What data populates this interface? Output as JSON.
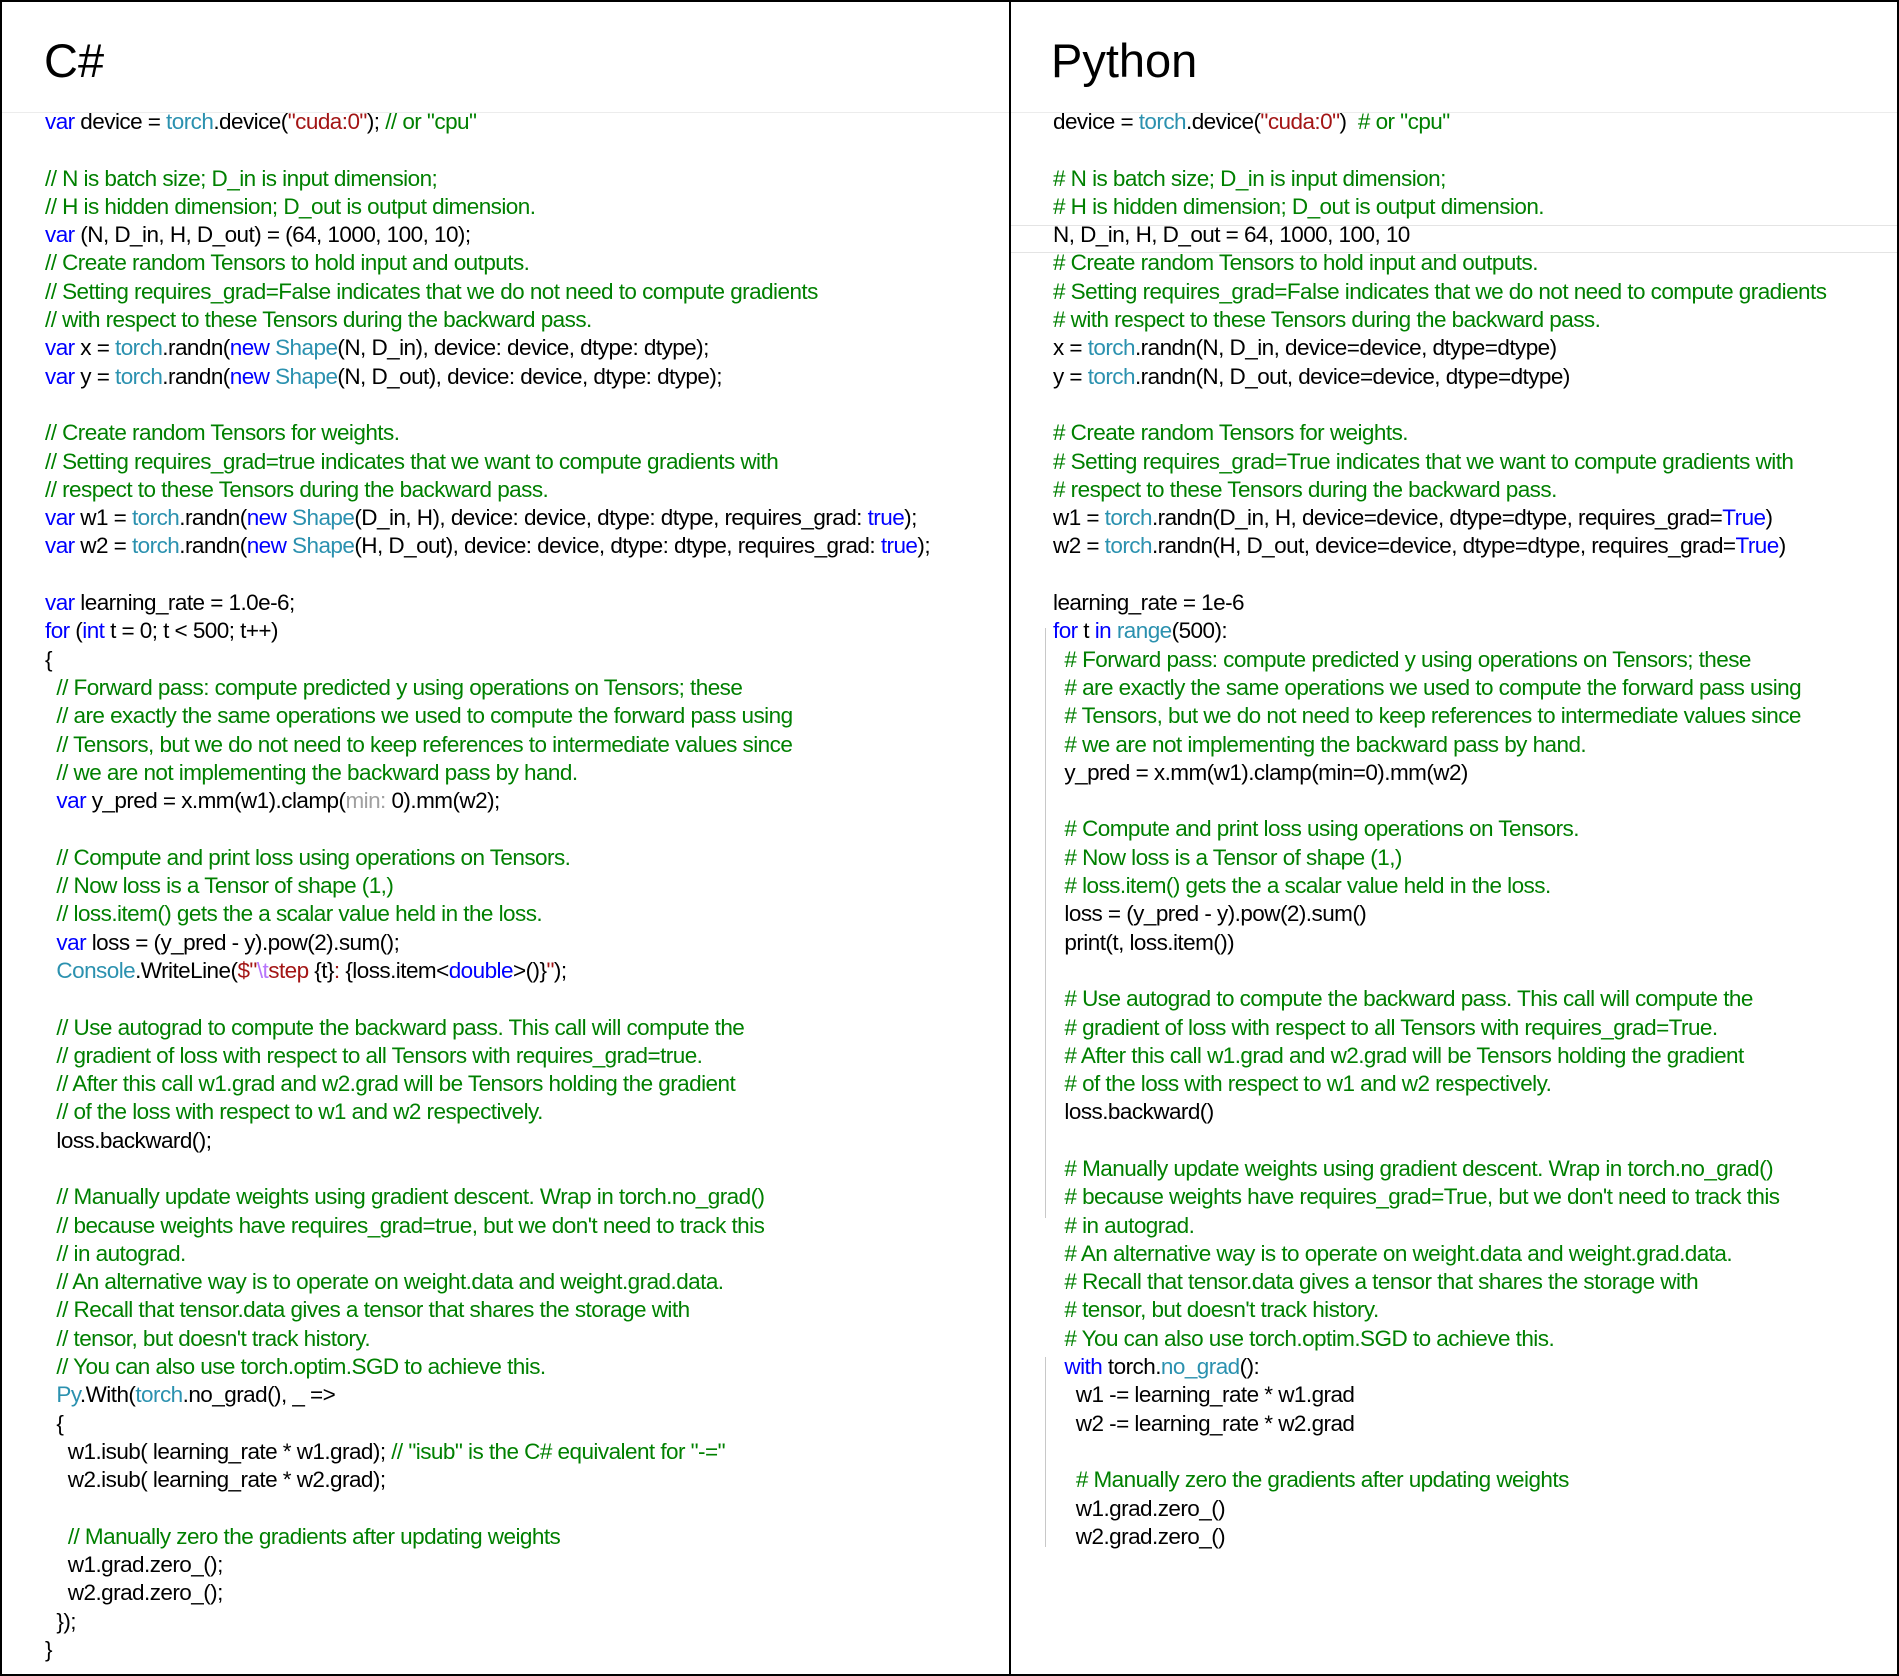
{
  "colors": {
    "keyword": "#0000ff",
    "type": "#2b91af",
    "comment": "#008000",
    "string": "#a31515",
    "escape": "#b776fb",
    "hint": "#a0a0a0",
    "text": "#000000"
  },
  "panels": [
    {
      "id": "csharp",
      "title": "C#",
      "lines": [
        [
          [
            "var",
            "kw"
          ],
          [
            " device = ",
            ""
          ],
          [
            "torch",
            "type"
          ],
          [
            ".device(",
            ""
          ],
          [
            "\"cuda:0\"",
            "str"
          ],
          [
            "); ",
            ""
          ],
          [
            "// or \"cpu\"",
            "cmt"
          ]
        ],
        [],
        [
          [
            "// N is batch size; D_in is input dimension;",
            "cmt"
          ]
        ],
        [
          [
            "// H is hidden dimension; D_out is output dimension.",
            "cmt"
          ]
        ],
        [
          [
            "var",
            "kw"
          ],
          [
            " (N, D_in, H, D_out) = (64, 1000, 100, 10);",
            ""
          ]
        ],
        [
          [
            "// Create random Tensors to hold input and outputs.",
            "cmt"
          ]
        ],
        [
          [
            "// Setting requires_grad=False indicates that we do not need to compute gradients",
            "cmt"
          ]
        ],
        [
          [
            "// with respect to these Tensors during the backward pass.",
            "cmt"
          ]
        ],
        [
          [
            "var",
            "kw"
          ],
          [
            " x = ",
            ""
          ],
          [
            "torch",
            "type"
          ],
          [
            ".randn(",
            ""
          ],
          [
            "new",
            "kw"
          ],
          [
            " ",
            ""
          ],
          [
            "Shape",
            "type"
          ],
          [
            "(N, D_in), device: device, dtype: dtype);",
            ""
          ]
        ],
        [
          [
            "var",
            "kw"
          ],
          [
            " y = ",
            ""
          ],
          [
            "torch",
            "type"
          ],
          [
            ".randn(",
            ""
          ],
          [
            "new",
            "kw"
          ],
          [
            " ",
            ""
          ],
          [
            "Shape",
            "type"
          ],
          [
            "(N, D_out), device: device, dtype: dtype);",
            ""
          ]
        ],
        [],
        [
          [
            "// Create random Tensors for weights.",
            "cmt"
          ]
        ],
        [
          [
            "// Setting requires_grad=true indicates that we want to compute gradients with",
            "cmt"
          ]
        ],
        [
          [
            "// respect to these Tensors during the backward pass.",
            "cmt"
          ]
        ],
        [
          [
            "var",
            "kw"
          ],
          [
            " w1 = ",
            ""
          ],
          [
            "torch",
            "type"
          ],
          [
            ".randn(",
            ""
          ],
          [
            "new",
            "kw"
          ],
          [
            " ",
            ""
          ],
          [
            "Shape",
            "type"
          ],
          [
            "(D_in, H), device: device, dtype: dtype, requires_grad: ",
            ""
          ],
          [
            "true",
            "kw"
          ],
          [
            ");",
            ""
          ]
        ],
        [
          [
            "var",
            "kw"
          ],
          [
            " w2 = ",
            ""
          ],
          [
            "torch",
            "type"
          ],
          [
            ".randn(",
            ""
          ],
          [
            "new",
            "kw"
          ],
          [
            " ",
            ""
          ],
          [
            "Shape",
            "type"
          ],
          [
            "(H, D_out), device: device, dtype: dtype, requires_grad: ",
            ""
          ],
          [
            "true",
            "kw"
          ],
          [
            ");",
            ""
          ]
        ],
        [],
        [
          [
            "var",
            "kw"
          ],
          [
            " learning_rate = 1.0e-6;",
            ""
          ]
        ],
        [
          [
            "for",
            "kw"
          ],
          [
            " (",
            ""
          ],
          [
            "int",
            "kw"
          ],
          [
            " t = 0; t < 500; t++)",
            ""
          ]
        ],
        [
          [
            "{",
            ""
          ]
        ],
        [
          [
            "  ",
            ""
          ],
          [
            "// Forward pass: compute predicted y using operations on Tensors; these",
            "cmt"
          ]
        ],
        [
          [
            "  ",
            ""
          ],
          [
            "// are exactly the same operations we used to compute the forward pass using",
            "cmt"
          ]
        ],
        [
          [
            "  ",
            ""
          ],
          [
            "// Tensors, but we do not need to keep references to intermediate values since",
            "cmt"
          ]
        ],
        [
          [
            "  ",
            ""
          ],
          [
            "// we are not implementing the backward pass by hand.",
            "cmt"
          ]
        ],
        [
          [
            "  ",
            ""
          ],
          [
            "var",
            "kw"
          ],
          [
            " y_pred = x.mm(w1).clamp(",
            ""
          ],
          [
            "min:",
            "hint"
          ],
          [
            " 0).mm(w2);",
            ""
          ]
        ],
        [],
        [
          [
            "  ",
            ""
          ],
          [
            "// Compute and print loss using operations on Tensors.",
            "cmt"
          ]
        ],
        [
          [
            "  ",
            ""
          ],
          [
            "// Now loss is a Tensor of shape (1,)",
            "cmt"
          ]
        ],
        [
          [
            "  ",
            ""
          ],
          [
            "// loss.item() gets the a scalar value held in the loss.",
            "cmt"
          ]
        ],
        [
          [
            "  ",
            ""
          ],
          [
            "var",
            "kw"
          ],
          [
            " loss = (y_pred - y).pow(2).sum();",
            ""
          ]
        ],
        [
          [
            "  ",
            ""
          ],
          [
            "Console",
            "type"
          ],
          [
            ".WriteLine(",
            ""
          ],
          [
            "$\"",
            "str"
          ],
          [
            "\\t",
            "esc"
          ],
          [
            "step ",
            "str"
          ],
          [
            "{t}",
            ""
          ],
          [
            ": ",
            "str"
          ],
          [
            "{loss.item<",
            ""
          ],
          [
            "double",
            "kw"
          ],
          [
            ">()}",
            ""
          ],
          [
            "\"",
            "str"
          ],
          [
            ");",
            ""
          ]
        ],
        [],
        [
          [
            "  ",
            ""
          ],
          [
            "// Use autograd to compute the backward pass. This call will compute the",
            "cmt"
          ]
        ],
        [
          [
            "  ",
            ""
          ],
          [
            "// gradient of loss with respect to all Tensors with requires_grad=true.",
            "cmt"
          ]
        ],
        [
          [
            "  ",
            ""
          ],
          [
            "// After this call w1.grad and w2.grad will be Tensors holding the gradient",
            "cmt"
          ]
        ],
        [
          [
            "  ",
            ""
          ],
          [
            "// of the loss with respect to w1 and w2 respectively.",
            "cmt"
          ]
        ],
        [
          [
            "  loss.backward();",
            ""
          ]
        ],
        [],
        [
          [
            "  ",
            ""
          ],
          [
            "// Manually update weights using gradient descent. Wrap in torch.no_grad()",
            "cmt"
          ]
        ],
        [
          [
            "  ",
            ""
          ],
          [
            "// because weights have requires_grad=true, but we don't need to track this",
            "cmt"
          ]
        ],
        [
          [
            "  ",
            ""
          ],
          [
            "// in autograd.",
            "cmt"
          ]
        ],
        [
          [
            "  ",
            ""
          ],
          [
            "// An alternative way is to operate on weight.data and weight.grad.data.",
            "cmt"
          ]
        ],
        [
          [
            "  ",
            ""
          ],
          [
            "// Recall that tensor.data gives a tensor that shares the storage with",
            "cmt"
          ]
        ],
        [
          [
            "  ",
            ""
          ],
          [
            "// tensor, but doesn't track history.",
            "cmt"
          ]
        ],
        [
          [
            "  ",
            ""
          ],
          [
            "// You can also use torch.optim.SGD to achieve this.",
            "cmt"
          ]
        ],
        [
          [
            "  ",
            ""
          ],
          [
            "Py",
            "type"
          ],
          [
            ".With(",
            ""
          ],
          [
            "torch",
            "type"
          ],
          [
            ".no_grad(), _ =>",
            ""
          ]
        ],
        [
          [
            "  {",
            ""
          ]
        ],
        [
          [
            "    w1.isub( learning_rate * w1.grad); ",
            ""
          ],
          [
            "// \"isub\" is the C# equivalent for \"-=\"",
            "cmt"
          ]
        ],
        [
          [
            "    w2.isub( learning_rate * w2.grad);",
            ""
          ]
        ],
        [],
        [
          [
            "    ",
            ""
          ],
          [
            "// Manually zero the gradients after updating weights",
            "cmt"
          ]
        ],
        [
          [
            "    w1.grad.zero_();",
            ""
          ]
        ],
        [
          [
            "    w2.grad.zero_();",
            ""
          ]
        ],
        [
          [
            "  });",
            ""
          ]
        ],
        [
          [
            "}",
            ""
          ]
        ]
      ]
    },
    {
      "id": "python",
      "title": "Python",
      "lines": [
        [
          [
            "device = ",
            ""
          ],
          [
            "torch",
            "type"
          ],
          [
            ".device(",
            ""
          ],
          [
            "\"cuda:0\"",
            "str"
          ],
          [
            ")  ",
            ""
          ],
          [
            "# or \"cpu\"",
            "cmt"
          ]
        ],
        [],
        [
          [
            "# N is batch size; D_in is input dimension;",
            "cmt"
          ]
        ],
        [
          [
            "# H is hidden dimension; D_out is output dimension.",
            "cmt"
          ]
        ],
        [
          [
            "N, D_in, H, D_out = 64, 1000, 100, 10",
            ""
          ]
        ],
        [
          [
            "# Create random Tensors to hold input and outputs.",
            "cmt"
          ]
        ],
        [
          [
            "# Setting requires_grad=False indicates that we do not need to compute gradients",
            "cmt"
          ]
        ],
        [
          [
            "# with respect to these Tensors during the backward pass.",
            "cmt"
          ]
        ],
        [
          [
            "x = ",
            ""
          ],
          [
            "torch",
            "type"
          ],
          [
            ".randn(N, D_in, device=device, dtype=dtype)",
            ""
          ]
        ],
        [
          [
            "y = ",
            ""
          ],
          [
            "torch",
            "type"
          ],
          [
            ".randn(N, D_out, device=device, dtype=dtype)",
            ""
          ]
        ],
        [],
        [
          [
            "# Create random Tensors for weights.",
            "cmt"
          ]
        ],
        [
          [
            "# Setting requires_grad=True indicates that we want to compute gradients with",
            "cmt"
          ]
        ],
        [
          [
            "# respect to these Tensors during the backward pass.",
            "cmt"
          ]
        ],
        [
          [
            "w1 = ",
            ""
          ],
          [
            "torch",
            "type"
          ],
          [
            ".randn(D_in, H, device=device, dtype=dtype, requires_grad=",
            ""
          ],
          [
            "True",
            "kw"
          ],
          [
            ")",
            ""
          ]
        ],
        [
          [
            "w2 = ",
            ""
          ],
          [
            "torch",
            "type"
          ],
          [
            ".randn(H, D_out, device=device, dtype=dtype, requires_grad=",
            ""
          ],
          [
            "True",
            "kw"
          ],
          [
            ")",
            ""
          ]
        ],
        [],
        [
          [
            "learning_rate = 1e-6",
            ""
          ]
        ],
        [
          [
            "for",
            "kw"
          ],
          [
            " t ",
            ""
          ],
          [
            "in",
            "kw"
          ],
          [
            " ",
            ""
          ],
          [
            "range",
            "type"
          ],
          [
            "(500):",
            ""
          ]
        ],
        [
          [
            "  ",
            ""
          ],
          [
            "# Forward pass: compute predicted y using operations on Tensors; these",
            "cmt"
          ]
        ],
        [
          [
            "  ",
            ""
          ],
          [
            "# are exactly the same operations we used to compute the forward pass using",
            "cmt"
          ]
        ],
        [
          [
            "  ",
            ""
          ],
          [
            "# Tensors, but we do not need to keep references to intermediate values since",
            "cmt"
          ]
        ],
        [
          [
            "  ",
            ""
          ],
          [
            "# we are not implementing the backward pass by hand.",
            "cmt"
          ]
        ],
        [
          [
            "  y_pred = x.mm(w1).clamp(min=0).mm(w2)",
            ""
          ]
        ],
        [],
        [
          [
            "  ",
            ""
          ],
          [
            "# Compute and print loss using operations on Tensors.",
            "cmt"
          ]
        ],
        [
          [
            "  ",
            ""
          ],
          [
            "# Now loss is a Tensor of shape (1,)",
            "cmt"
          ]
        ],
        [
          [
            "  ",
            ""
          ],
          [
            "# loss.item() gets the a scalar value held in the loss.",
            "cmt"
          ]
        ],
        [
          [
            "  loss = (y_pred - y).pow(2).sum()",
            ""
          ]
        ],
        [
          [
            "  print(t, loss.item())",
            ""
          ]
        ],
        [],
        [
          [
            "  ",
            ""
          ],
          [
            "# Use autograd to compute the backward pass. This call will compute the",
            "cmt"
          ]
        ],
        [
          [
            "  ",
            ""
          ],
          [
            "# gradient of loss with respect to all Tensors with requires_grad=True.",
            "cmt"
          ]
        ],
        [
          [
            "  ",
            ""
          ],
          [
            "# After this call w1.grad and w2.grad will be Tensors holding the gradient",
            "cmt"
          ]
        ],
        [
          [
            "  ",
            ""
          ],
          [
            "# of the loss with respect to w1 and w2 respectively.",
            "cmt"
          ]
        ],
        [
          [
            "  loss.backward()",
            ""
          ]
        ],
        [],
        [
          [
            "  ",
            ""
          ],
          [
            "# Manually update weights using gradient descent. Wrap in torch.no_grad()",
            "cmt"
          ]
        ],
        [
          [
            "  ",
            ""
          ],
          [
            "# because weights have requires_grad=True, but we don't need to track this",
            "cmt"
          ]
        ],
        [
          [
            "  ",
            ""
          ],
          [
            "# in autograd.",
            "cmt"
          ]
        ],
        [
          [
            "  ",
            ""
          ],
          [
            "# An alternative way is to operate on weight.data and weight.grad.data.",
            "cmt"
          ]
        ],
        [
          [
            "  ",
            ""
          ],
          [
            "# Recall that tensor.data gives a tensor that shares the storage with",
            "cmt"
          ]
        ],
        [
          [
            "  ",
            ""
          ],
          [
            "# tensor, but doesn't track history.",
            "cmt"
          ]
        ],
        [
          [
            "  ",
            ""
          ],
          [
            "# You can also use torch.optim.SGD to achieve this.",
            "cmt"
          ]
        ],
        [
          [
            "  ",
            ""
          ],
          [
            "with",
            "kw"
          ],
          [
            " torch.",
            ""
          ],
          [
            "no_grad",
            "type"
          ],
          [
            "():",
            ""
          ]
        ],
        [
          [
            "    w1 -= learning_rate * w1.grad",
            ""
          ]
        ],
        [
          [
            "    w2 -= learning_rate * w2.grad",
            ""
          ]
        ],
        [],
        [
          [
            "    ",
            ""
          ],
          [
            "# Manually zero the gradients after updating weights",
            "cmt"
          ]
        ],
        [
          [
            "    w1.grad.zero_()",
            ""
          ]
        ],
        [
          [
            "    w2.grad.zero_()",
            ""
          ]
        ]
      ]
    }
  ]
}
